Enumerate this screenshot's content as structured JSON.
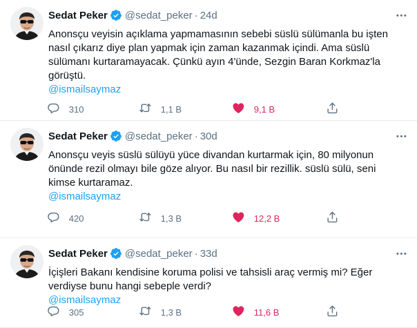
{
  "tweets": [
    {
      "author_name": "Sedat Peker",
      "handle": "@sedat_peker",
      "separator": "·",
      "time": "24d",
      "text_lines": [
        "Anonsçu veyisin açıklama yapmamasının sebebi süslü sülümanla bu işten",
        "nasıl çıkarız diye plan yapmak için zaman kazanmak içindi. Ama süslü",
        "sülümanı kurtaramayacak. Çünkü ayın 4'ünde, Sezgin Baran Korkmaz'la",
        "görüştü."
      ],
      "mention": "@ismailsaymaz",
      "replies": "310",
      "retweets": "1,1 B",
      "likes": "9,1 B",
      "liked": true
    },
    {
      "author_name": "Sedat Peker",
      "handle": "@sedat_peker",
      "separator": "·",
      "time": "30d",
      "text_lines": [
        "Anonsçu veyis süslü sülüyü yüce divandan kurtarmak için, 80 milyonun",
        "önünde rezil olmayı bile göze alıyor. Bu nasıl bir rezillik. süslü sülü, seni",
        "kimse kurtaramaz."
      ],
      "mention": "@ismailsaymaz",
      "replies": "420",
      "retweets": "1,3 B",
      "likes": "12,2 B",
      "liked": true
    },
    {
      "author_name": "Sedat Peker",
      "handle": "@sedat_peker",
      "separator": "·",
      "time": "33d",
      "text_lines": [
        "İçişleri Bakanı kendisine koruma polisi ve tahsisli araç vermiş mi? Eğer",
        "verdiyse bunu hangi sebeple verdi?"
      ],
      "mention": "@ismailsaymaz",
      "replies": "305",
      "retweets": "1,3 B",
      "likes": "11,6 B",
      "liked": true
    }
  ],
  "colors": {
    "name": "#0f1419",
    "secondary": "#5b7083",
    "mention": "#1da1f2",
    "like": "#e0245e",
    "verified": "#1da1f2",
    "border": "#e6ecf0"
  },
  "icons": {
    "verified": "verified-badge-icon",
    "more": "more-options-icon",
    "reply": "reply-icon",
    "retweet": "retweet-icon",
    "like": "heart-filled-icon",
    "share": "share-icon"
  }
}
